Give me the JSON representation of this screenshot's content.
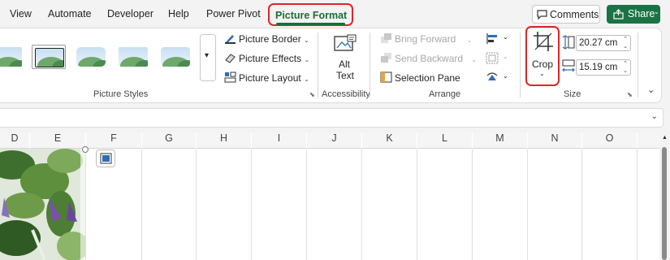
{
  "tabs": [
    "View",
    "Automate",
    "Developer",
    "Help",
    "Power Pivot",
    "Picture Format"
  ],
  "header": {
    "comments_label": "Comments",
    "share_label": "Share"
  },
  "ribbon": {
    "picture_styles": {
      "label": "Picture Styles",
      "border": "Picture Border",
      "effects": "Picture Effects",
      "layout": "Picture Layout"
    },
    "accessibility": {
      "label": "Accessibility",
      "alt_text_line1": "Alt",
      "alt_text_line2": "Text"
    },
    "arrange": {
      "label": "Arrange",
      "bring_forward": "Bring Forward",
      "send_backward": "Send Backward",
      "selection_pane": "Selection Pane"
    },
    "size": {
      "label": "Size",
      "crop": "Crop",
      "height": "20.27 cm",
      "width": "15.19 cm"
    }
  },
  "grid": {
    "columns": [
      "D",
      "E",
      "F",
      "G",
      "H",
      "I",
      "J",
      "K",
      "L",
      "M",
      "N",
      "O"
    ]
  },
  "colors": {
    "accent": "#1a6e39",
    "highlight": "#e0242a",
    "share": "#1a7343"
  }
}
